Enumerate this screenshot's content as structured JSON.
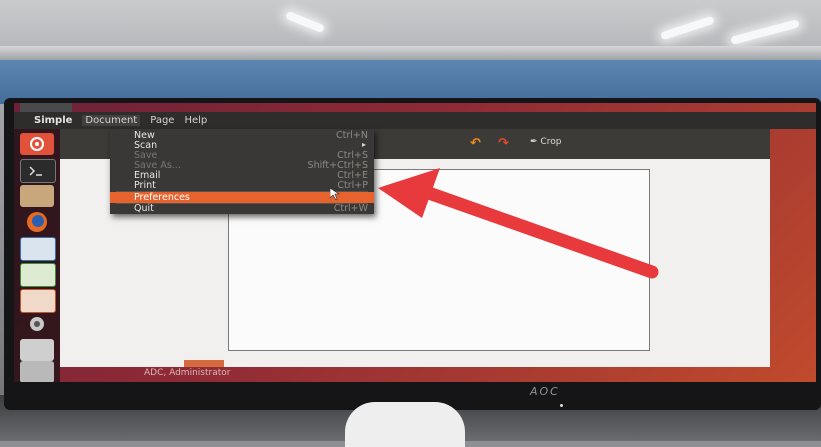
{
  "menubar": {
    "app_name": "Simple",
    "menus": [
      "Document",
      "Page",
      "Help"
    ]
  },
  "document_menu": {
    "items": [
      {
        "label": "New",
        "accel": "Ctrl+N",
        "enabled": true
      },
      {
        "label": "Scan",
        "submenu": true,
        "enabled": true
      },
      {
        "label": "Save",
        "accel": "Ctrl+S",
        "enabled": false
      },
      {
        "label": "Save As...",
        "accel": "Shift+Ctrl+S",
        "enabled": false
      },
      {
        "label": "Email",
        "accel": "Ctrl+E",
        "enabled": true
      },
      {
        "label": "Print",
        "accel": "Ctrl+P",
        "enabled": true
      },
      {
        "label": "Preferences",
        "highlighted": true,
        "enabled": true
      },
      {
        "label": "Quit",
        "accel": "Ctrl+W",
        "enabled": true
      }
    ]
  },
  "toolbar": {
    "crop_label": "Crop"
  },
  "status": {
    "text": "ADC, Administrator"
  },
  "monitor": {
    "brand": "AOC"
  },
  "colors": {
    "highlight": "#e7632e",
    "arrow": "#e8393d",
    "menu_bg": "#3a3836"
  },
  "icons": {
    "launcher": [
      "ubuntu-logo-icon",
      "terminal-icon",
      "files-icon",
      "firefox-icon",
      "writer-icon",
      "calc-icon",
      "impress-icon",
      "settings-icon",
      "scanner-icon",
      "printer-icon"
    ]
  }
}
